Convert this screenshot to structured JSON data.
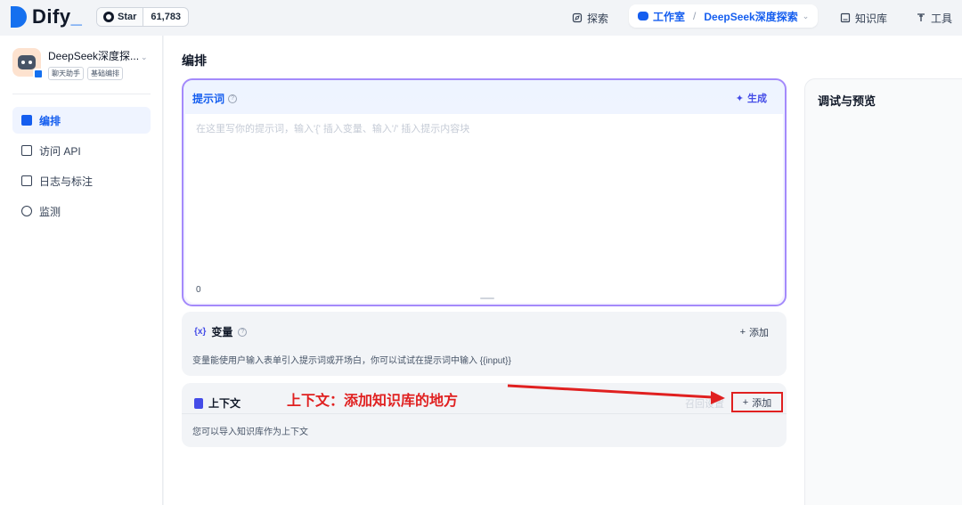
{
  "brand": {
    "name": "Dify",
    "underscore": "_"
  },
  "github": {
    "star_label": "Star",
    "count": "61,783"
  },
  "nav": {
    "explore": "探索",
    "studio": "工作室",
    "separator": "/",
    "current_app": "DeepSeek深度探索",
    "knowledge": "知识库",
    "tools": "工具"
  },
  "app": {
    "name": "DeepSeek深度探...",
    "tags": [
      "聊天助手",
      "基础编排"
    ]
  },
  "sidebar": {
    "items": [
      {
        "label": "编排",
        "icon": "layout-icon",
        "active": true
      },
      {
        "label": "访问 API",
        "icon": "terminal-icon",
        "active": false
      },
      {
        "label": "日志与标注",
        "icon": "logs-icon",
        "active": false
      },
      {
        "label": "监测",
        "icon": "gauge-icon",
        "active": false
      }
    ]
  },
  "main": {
    "title": "编排",
    "prompt": {
      "title": "提示词",
      "generate": "生成",
      "placeholder": "在这里写你的提示词，输入'{' 插入变量、输入'/' 插入提示内容块",
      "char_count": "0"
    },
    "variables": {
      "title": "变量",
      "add": "添加",
      "description": "变量能使用户输入表单引入提示词或开场白，你可以试试在提示词中输入 {{input}}"
    },
    "context": {
      "title": "上下文",
      "recall": "召回设置",
      "add": "添加",
      "description": "您可以导入知识库作为上下文"
    }
  },
  "annotation": {
    "text": "上下文：添加知识库的地方",
    "color": "#e02020"
  },
  "debug": {
    "title": "调试与预览"
  },
  "colors": {
    "accent": "#155eef",
    "prompt_border": "#a48afb",
    "annotation": "#e02020"
  }
}
